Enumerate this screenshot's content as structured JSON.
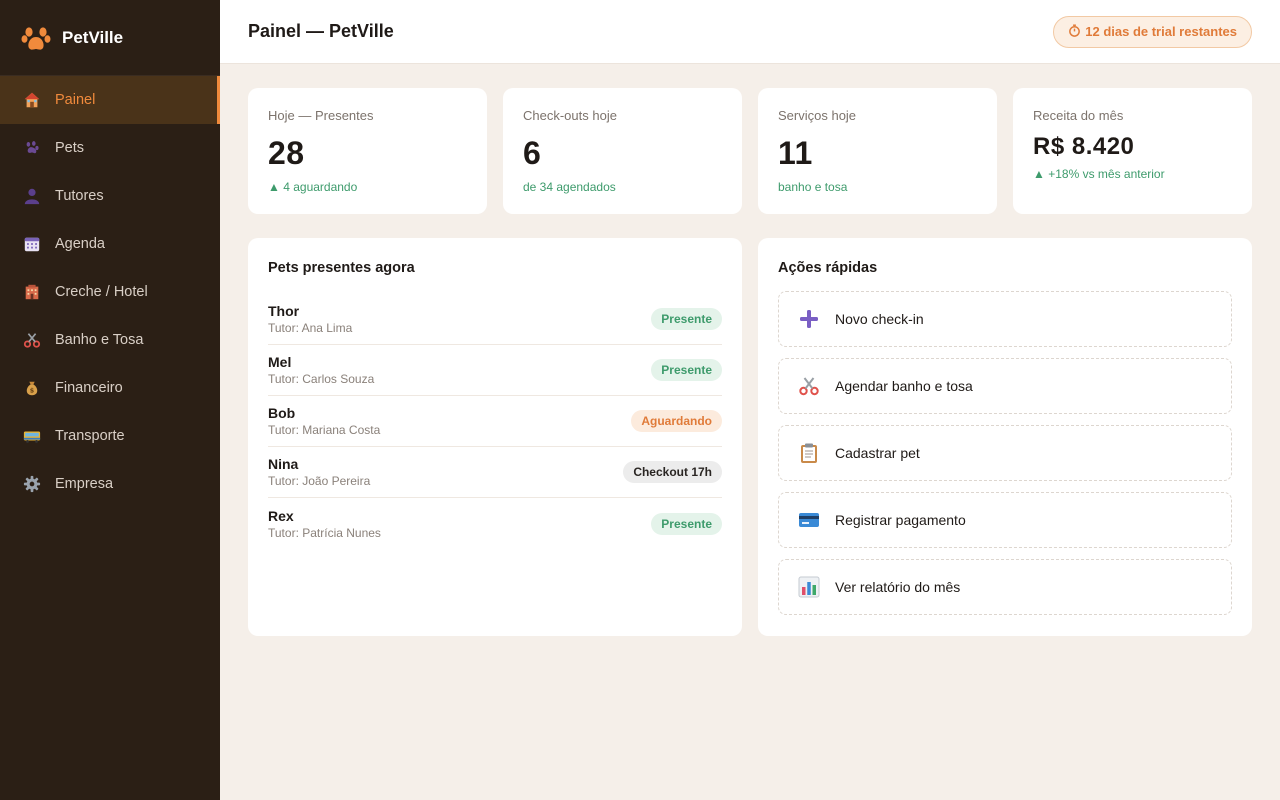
{
  "brand": {
    "name": "PetVille"
  },
  "sidebar": {
    "items": [
      {
        "label": "Painel",
        "icon": "house-icon",
        "active": true
      },
      {
        "label": "Pets",
        "icon": "paw-icon"
      },
      {
        "label": "Tutores",
        "icon": "person-icon"
      },
      {
        "label": "Agenda",
        "icon": "calendar-icon"
      },
      {
        "label": "Creche / Hotel",
        "icon": "hotel-icon"
      },
      {
        "label": "Banho e Tosa",
        "icon": "scissors-icon"
      },
      {
        "label": "Financeiro",
        "icon": "money-bag-icon"
      },
      {
        "label": "Transporte",
        "icon": "bus-icon"
      },
      {
        "label": "Empresa",
        "icon": "gear-icon"
      }
    ]
  },
  "header": {
    "title": "Painel — PetVille",
    "trial": "12 dias de trial restantes"
  },
  "stats": [
    {
      "label": "Hoje — Presentes",
      "value": "28",
      "sub": "▲ 4 aguardando"
    },
    {
      "label": "Check-outs hoje",
      "value": "6",
      "sub": "de 34 agendados"
    },
    {
      "label": "Serviços hoje",
      "value": "11",
      "sub": "banho e tosa"
    },
    {
      "label": "Receita do mês",
      "value": "R$ 8.420",
      "sub": "▲ +18% vs mês anterior"
    }
  ],
  "pets_panel": {
    "title": "Pets presentes agora",
    "pets": [
      {
        "name": "Thor",
        "tutor": "Tutor: Ana Lima",
        "status": "Presente",
        "status_type": "presente"
      },
      {
        "name": "Mel",
        "tutor": "Tutor: Carlos Souza",
        "status": "Presente",
        "status_type": "presente"
      },
      {
        "name": "Bob",
        "tutor": "Tutor: Mariana Costa",
        "status": "Aguardando",
        "status_type": "aguardando"
      },
      {
        "name": "Nina",
        "tutor": "Tutor: João Pereira",
        "status": "Checkout 17h",
        "status_type": "checkout"
      },
      {
        "name": "Rex",
        "tutor": "Tutor: Patrícia Nunes",
        "status": "Presente",
        "status_type": "presente"
      }
    ]
  },
  "actions_panel": {
    "title": "Ações rápidas",
    "actions": [
      {
        "label": "Novo check-in",
        "icon": "plus-icon"
      },
      {
        "label": "Agendar banho e tosa",
        "icon": "scissors-icon"
      },
      {
        "label": "Cadastrar pet",
        "icon": "clipboard-icon"
      },
      {
        "label": "Registrar pagamento",
        "icon": "credit-card-icon"
      },
      {
        "label": "Ver relatório do mês",
        "icon": "bar-chart-icon"
      }
    ]
  },
  "colors": {
    "accent": "#f08a3c",
    "sidebar_bg": "#2b1f15",
    "page_bg": "#f5efe9",
    "positive": "#3e9b6c"
  }
}
